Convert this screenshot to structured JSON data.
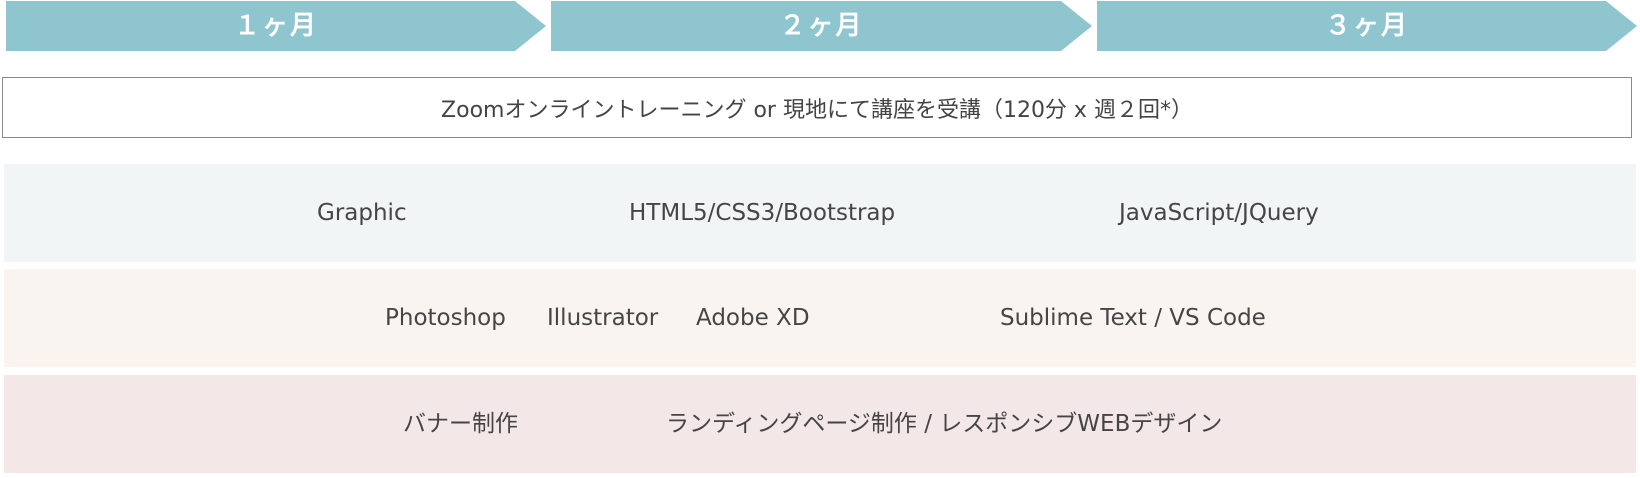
{
  "timeline": {
    "color": "#8ec5cf",
    "months": [
      "１ヶ月",
      "２ヶ月",
      "３ヶ月"
    ]
  },
  "method": {
    "text": "Zoomオンライントレーニング or  現地にて講座を受講（120分 x 週２回*）"
  },
  "rows": [
    {
      "background": "#f1f5f5",
      "items": [
        "Graphic",
        "HTML5/CSS3/Bootstrap",
        "JavaScript/JQuery"
      ]
    },
    {
      "background": "#f9f4ef",
      "items": [
        "Photoshop",
        "Illustrator",
        "Adobe XD",
        "Sublime Text / VS Code"
      ]
    },
    {
      "background": "#f4e7e8",
      "items": [
        "バナー制作",
        "ランディングページ制作 / レスポンシブWEBデザイン"
      ]
    }
  ]
}
